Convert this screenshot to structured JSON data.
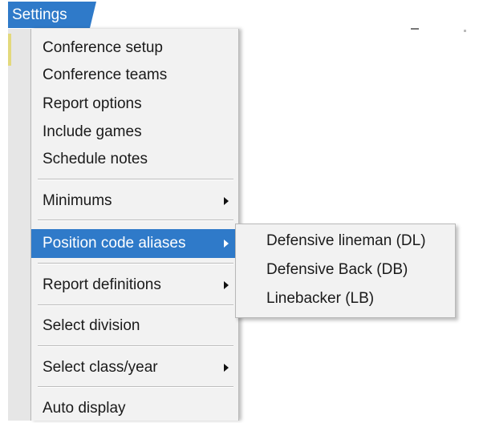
{
  "menubar": {
    "title": "Settings"
  },
  "menu": {
    "items": [
      {
        "label": "Conference setup"
      },
      {
        "label": "Conference teams"
      },
      {
        "label": "Report options"
      },
      {
        "label": "Include games"
      },
      {
        "label": "Schedule notes"
      },
      {
        "label": "Minimums",
        "has_submenu": true
      },
      {
        "label": "Position code aliases",
        "has_submenu": true,
        "selected": true
      },
      {
        "label": "Report definitions",
        "has_submenu": true
      },
      {
        "label": "Select division"
      },
      {
        "label": "Select class/year",
        "has_submenu": true
      },
      {
        "label": "Auto display"
      }
    ]
  },
  "submenu": {
    "items": [
      {
        "label": "Defensive lineman (DL)"
      },
      {
        "label": "Defensive Back (DB)"
      },
      {
        "label": "Linebacker (LB)"
      }
    ]
  },
  "colors": {
    "selection": "#2f7ac9",
    "menu_background": "#f2f2f2"
  }
}
